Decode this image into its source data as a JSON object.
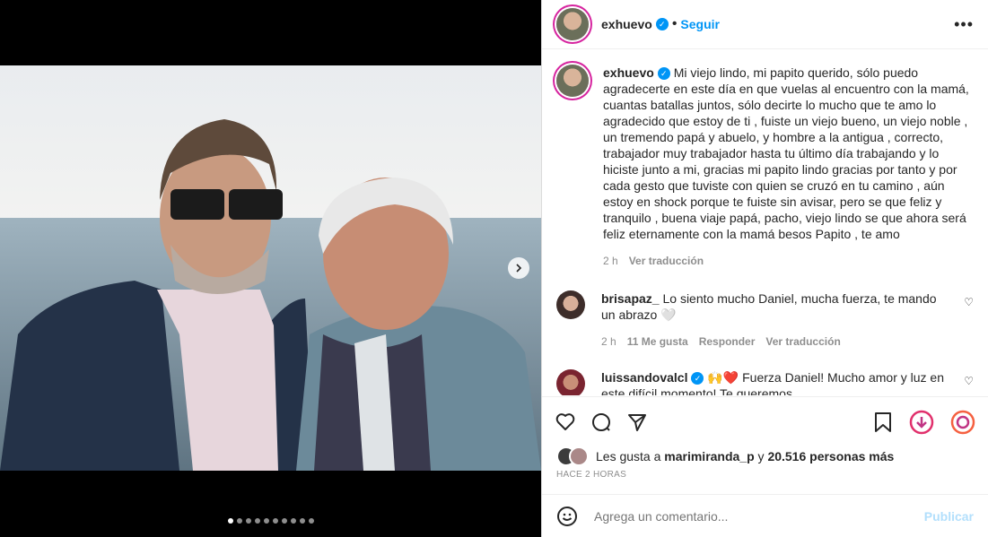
{
  "post": {
    "username": "exhuevo",
    "follow_label": "Seguir",
    "separator": "•",
    "more_label": "•••",
    "caption": "Mi viejo lindo, mi papito querido, sólo puedo agradecerte en este día en que vuelas al encuentro con la mamá, cuantas batallas juntos, sólo decirte lo mucho que te amo lo agradecido que estoy de ti , fuiste un viejo bueno, un viejo noble , un tremendo papá y abuelo, y hombre a la antigua , correcto, trabajador muy trabajador hasta tu último día trabajando y lo hiciste junto a mi, gracias mi papito lindo gracias por tanto y por cada gesto que tuviste con quien se cruzó en tu camino , aún estoy en shock porque te fuiste sin avisar, pero se que feliz y tranquilo , buena viaje papá, pacho, viejo lindo se que ahora será feliz eternamente con la mamá besos Papito , te amo",
    "caption_time": "2 h",
    "see_translation": "Ver traducción"
  },
  "comments": [
    {
      "username": "brisapaz_",
      "text": "Lo siento mucho Daniel, mucha fuerza, te mando un abrazo 🤍",
      "time": "2 h",
      "likes": "11 Me gusta",
      "reply": "Responder",
      "translate": "Ver traducción"
    },
    {
      "username": "luissandovalcl",
      "text": "🙌❤️ Fuerza Daniel! Mucho amor y luz en este difícil momento! Te queremos"
    }
  ],
  "likes": {
    "prefix": "Les gusta a",
    "user": "marimiranda_p",
    "middle": "y",
    "count": "20.516 personas más"
  },
  "timestamp": "HACE 2 HORAS",
  "comment_box": {
    "placeholder": "Agrega un comentario...",
    "publish": "Publicar"
  },
  "carousel": {
    "total": 10,
    "active_index": 0
  },
  "colors": {
    "accent": "#0095f6",
    "publish_disabled": "#b2dffc",
    "text": "#262626",
    "muted": "#8e8e8e"
  }
}
